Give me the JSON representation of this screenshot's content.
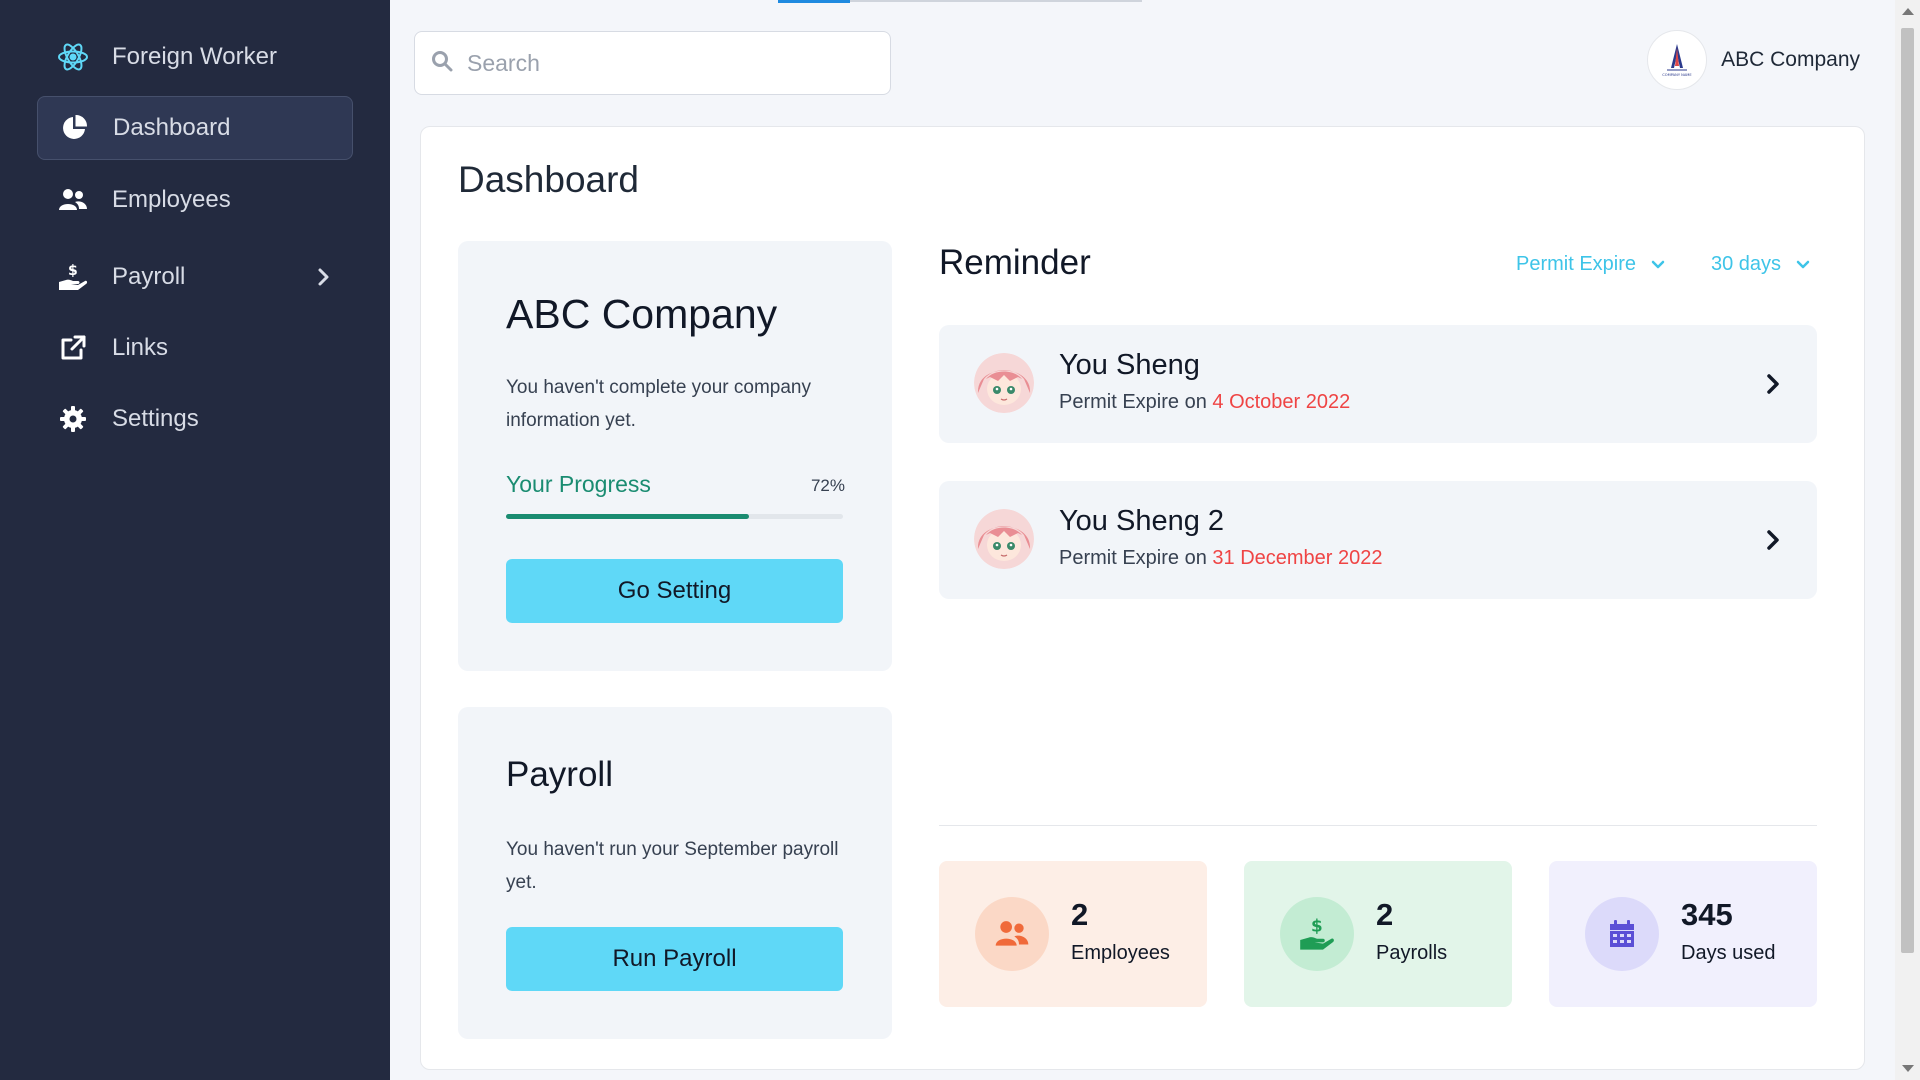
{
  "sidebar": {
    "brand": "Foreign Worker",
    "items": [
      {
        "label": "Dashboard",
        "icon": "pie-chart-icon",
        "active": true
      },
      {
        "label": "Employees",
        "icon": "users-icon"
      },
      {
        "label": "Payroll",
        "icon": "hand-dollar-icon",
        "has_children": true
      },
      {
        "label": "Links",
        "icon": "external-link-icon"
      },
      {
        "label": "Settings",
        "icon": "gear-icon"
      }
    ]
  },
  "topbar": {
    "search_placeholder": "Search",
    "company_name": "ABC Company",
    "logo_caption": "COMPANY NAME"
  },
  "page": {
    "title": "Dashboard"
  },
  "company_panel": {
    "title": "ABC Company",
    "message": "You haven't complete your company information yet.",
    "progress_label": "Your Progress",
    "progress_value": 72,
    "progress_text": "72%",
    "button_label": "Go Setting"
  },
  "payroll_panel": {
    "title": "Payroll",
    "message": "You haven't run your September payroll yet.",
    "button_label": "Run Payroll"
  },
  "reminder": {
    "title": "Reminder",
    "filter_type": "Permit Expire",
    "filter_range": "30 days",
    "items": [
      {
        "name": "You Sheng",
        "prefix": "Permit Expire on ",
        "date": "4 October 2022"
      },
      {
        "name": "You Sheng 2",
        "prefix": "Permit Expire on ",
        "date": "31 December 2022"
      }
    ]
  },
  "stats": [
    {
      "value": "2",
      "label": "Employees",
      "icon": "users-icon",
      "bg": "#fdeee6",
      "circle": "#fbd8c6",
      "color": "#f06a3a"
    },
    {
      "value": "2",
      "label": "Payrolls",
      "icon": "hand-dollar-icon",
      "bg": "#e2f5e9",
      "circle": "#c3ecd3",
      "color": "#1f9d55"
    },
    {
      "value": "345",
      "label": "Days used",
      "icon": "calendar-icon",
      "bg": "#f1f0fd",
      "circle": "#dcdafa",
      "color": "#5b4fd6"
    }
  ],
  "colors": {
    "sidebar_bg": "#232a40",
    "accent_cyan": "#5fd8f7",
    "progress_green": "#1a8c71",
    "date_red": "#ef4444"
  }
}
